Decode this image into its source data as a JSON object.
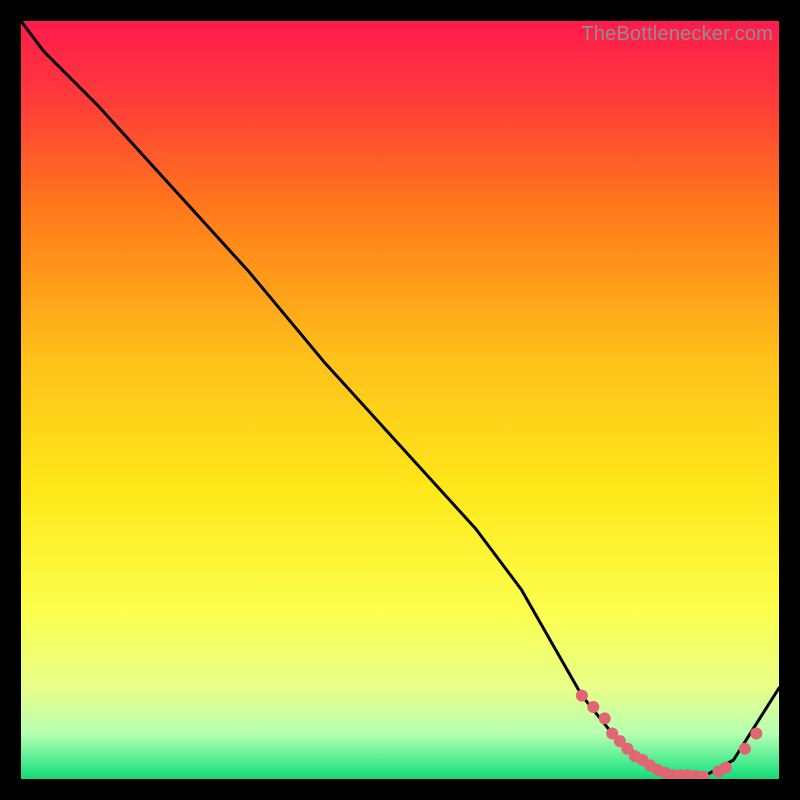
{
  "watermark": "TheBottlenecker.com",
  "colors": {
    "frame_bg": "#000000",
    "gradient_top": "#ff1744",
    "gradient_mid1": "#ff7a1a",
    "gradient_mid2": "#ffd81a",
    "gradient_mid3": "#fff96a",
    "gradient_bottom": "#2ee87b",
    "curve": "#000000",
    "dot": "#e06673"
  },
  "chart_data": {
    "type": "line",
    "title": "",
    "xlabel": "",
    "ylabel": "",
    "xlim": [
      0,
      100
    ],
    "ylim": [
      0,
      100
    ],
    "series": [
      {
        "name": "bottleneck-curve",
        "x": [
          0,
          3,
          10,
          20,
          30,
          40,
          50,
          60,
          66,
          70,
          74,
          78,
          82,
          86,
          90,
          94,
          100
        ],
        "y": [
          100,
          96,
          89,
          78,
          67,
          55,
          44,
          33,
          25,
          18,
          11,
          6,
          2.5,
          0.5,
          0.3,
          2.5,
          12
        ]
      }
    ],
    "markers": {
      "name": "highlight-dots",
      "x": [
        74,
        75.5,
        77,
        78,
        79,
        80,
        81,
        82,
        83,
        84,
        85,
        86,
        87,
        88,
        89,
        90,
        92,
        93,
        95.5,
        97
      ],
      "y": [
        11,
        9.5,
        8,
        6,
        5,
        4,
        3,
        2.5,
        1.8,
        1.2,
        0.8,
        0.5,
        0.5,
        0.5,
        0.4,
        0.3,
        1,
        1.5,
        4,
        6
      ]
    },
    "gradient_stops": [
      {
        "pos": 0.0,
        "color": "#ff1a4d"
      },
      {
        "pos": 0.1,
        "color": "#ff3a3a"
      },
      {
        "pos": 0.25,
        "color": "#ff7a1a"
      },
      {
        "pos": 0.45,
        "color": "#ffc21a"
      },
      {
        "pos": 0.62,
        "color": "#ffe81a"
      },
      {
        "pos": 0.78,
        "color": "#fbff4d"
      },
      {
        "pos": 0.88,
        "color": "#e8ff8a"
      },
      {
        "pos": 0.94,
        "color": "#b6ffb0"
      },
      {
        "pos": 0.985,
        "color": "#37e88a"
      },
      {
        "pos": 1.0,
        "color": "#18d778"
      }
    ]
  }
}
